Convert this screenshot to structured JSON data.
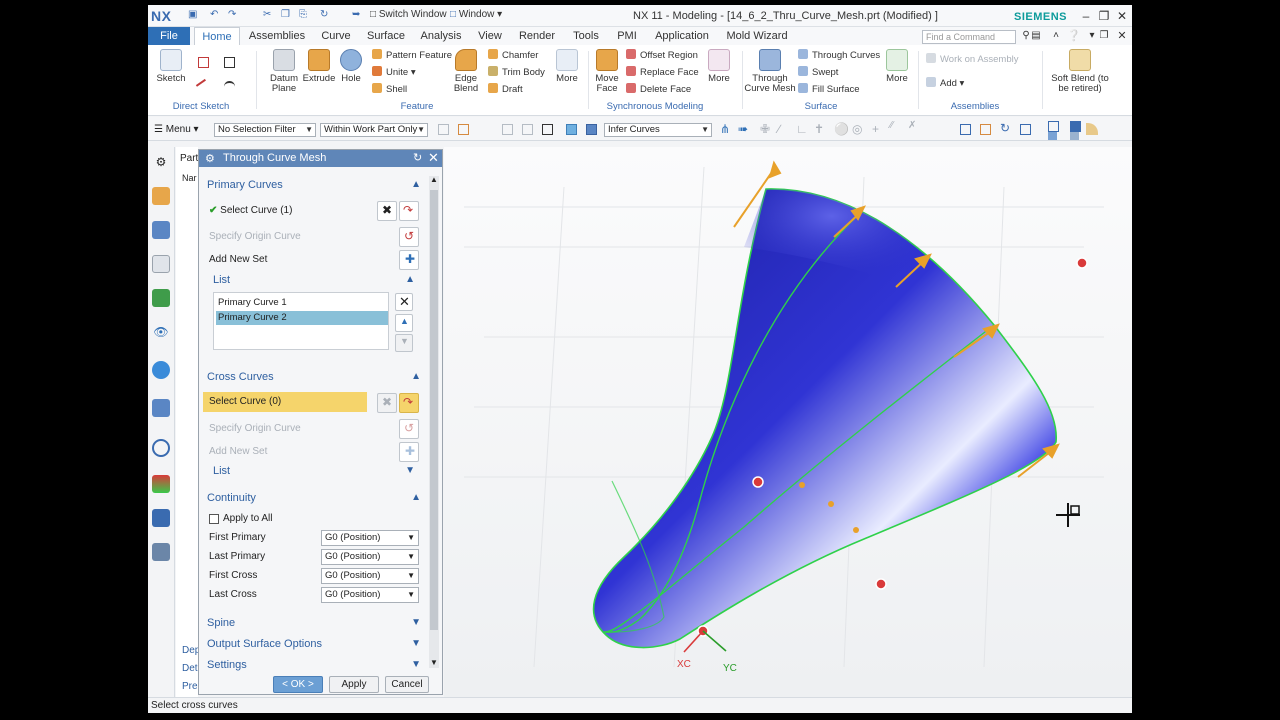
{
  "app": {
    "logo": "NX",
    "window_menu_label": "Switch Window",
    "window_label": "Window",
    "title": "NX 11 - Modeling - [14_6_2_Thru_Curve_Mesh.prt (Modified) ]",
    "brand": "SIEMENS"
  },
  "tabs": [
    "File",
    "Home",
    "Assemblies",
    "Curve",
    "Surface",
    "Analysis",
    "View",
    "Render",
    "Tools",
    "PMI",
    "Application",
    "Mold Wizard"
  ],
  "search": {
    "placeholder": "Find a Command"
  },
  "ribbon": {
    "sketch": "Sketch",
    "direct_sketch": "Direct Sketch",
    "datum_plane": "Datum Plane",
    "extrude": "Extrude",
    "hole": "Hole",
    "pattern_feature": "Pattern Feature",
    "unite": "Unite",
    "shell": "Shell",
    "edge_blend": "Edge Blend",
    "chamfer": "Chamfer",
    "trim_body": "Trim Body",
    "draft": "Draft",
    "more1": "More",
    "feature": "Feature",
    "move_face": "Move Face",
    "offset_region": "Offset Region",
    "replace_face": "Replace Face",
    "delete_face": "Delete Face",
    "more2": "More",
    "sync_modeling": "Synchronous Modeling",
    "through_curve_mesh": "Through Curve Mesh",
    "through_curves": "Through Curves",
    "swept": "Swept",
    "fill_surface": "Fill Surface",
    "more3": "More",
    "surface": "Surface",
    "work_on_assembly": "Work on Assembly",
    "add": "Add",
    "soft_blend": "Soft Blend (to be retired)",
    "assemblies": "Assemblies"
  },
  "selection": {
    "menu": "Menu",
    "filter": "No Selection Filter",
    "scope": "Within Work Part Only",
    "curve_rule": "Infer Curves"
  },
  "dialog": {
    "title": "Through Curve Mesh",
    "primary_curves": "Primary Curves",
    "select_curve_1": "Select Curve (1)",
    "specify_origin_curve_1": "Specify Origin Curve",
    "add_new_set_1": "Add New Set",
    "list_1": "List",
    "list_items": [
      "Primary Curve  1",
      "Primary Curve  2"
    ],
    "cross_curves": "Cross Curves",
    "select_curve_0": "Select Curve (0)",
    "specify_origin_curve_2": "Specify Origin Curve",
    "add_new_set_2": "Add New Set",
    "list_2": "List",
    "continuity": "Continuity",
    "apply_to_all": "Apply to All",
    "first_primary": "First Primary",
    "last_primary": "Last Primary",
    "first_cross": "First Cross",
    "last_cross": "Last Cross",
    "first_primary_value": "G0 (Position)",
    "last_primary_value": "G0 (Position)",
    "first_cross_value": "G0 (Position)",
    "last_cross_value": "G0 (Position)",
    "spine": "Spine",
    "output_surface_options": "Output Surface Options",
    "settings": "Settings",
    "ok": "< OK >",
    "apply": "Apply",
    "cancel": "Cancel"
  },
  "navigator": {
    "tab": "Part",
    "col": "Nar",
    "rows": [
      "Dep",
      "Det",
      "Pre"
    ]
  },
  "viewport": {
    "axis_x": "XC",
    "axis_y": "YC"
  },
  "status": {
    "text": "Select cross curves"
  },
  "colors": {
    "accent": "#2e6fb6",
    "highlight": "#f5d46b",
    "surface": "#2b2fc9",
    "edge": "#2fd14a"
  }
}
